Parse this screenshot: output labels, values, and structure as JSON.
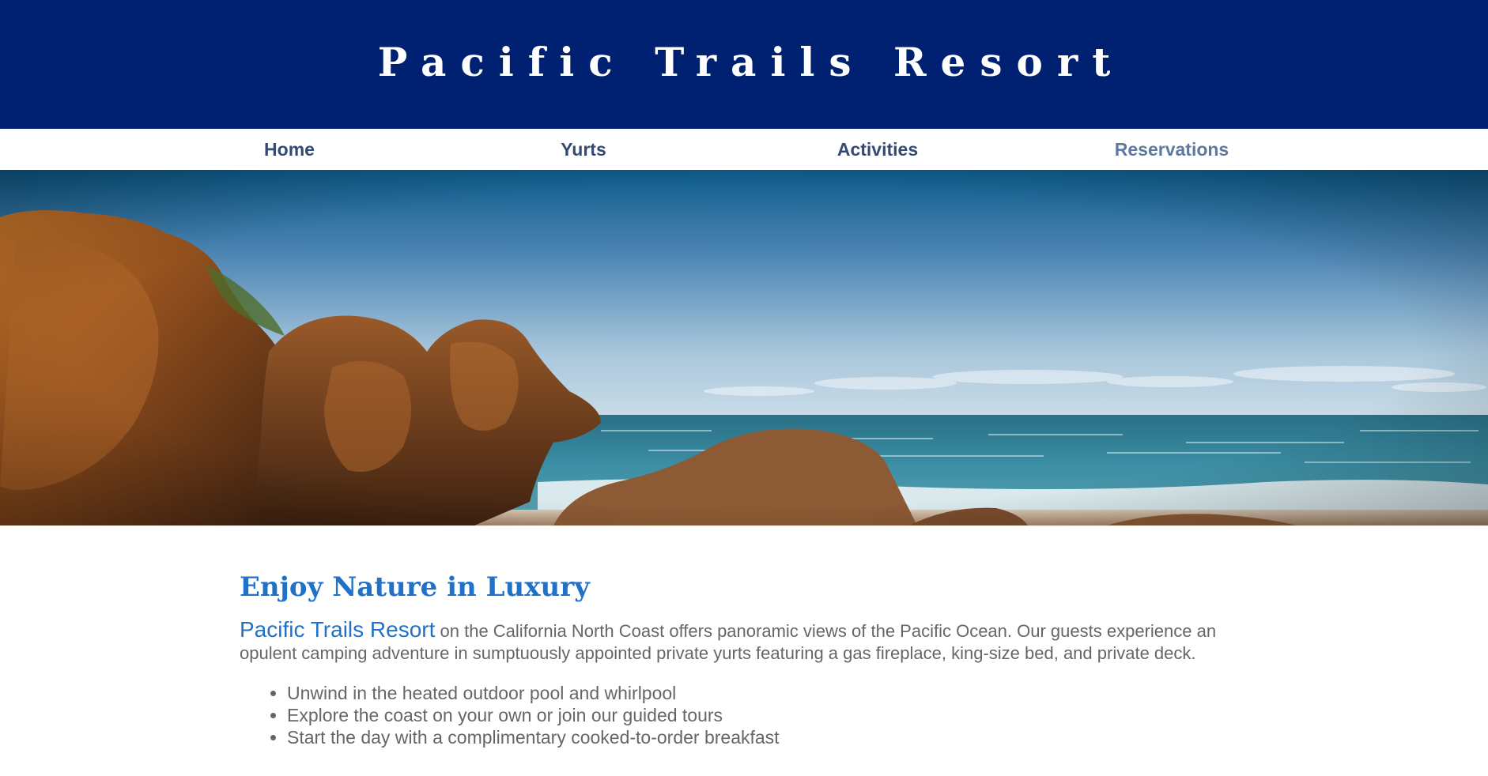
{
  "header": {
    "title": "Pacific Trails Resort"
  },
  "nav": {
    "items": [
      {
        "label": "Home"
      },
      {
        "label": "Yurts"
      },
      {
        "label": "Activities"
      },
      {
        "label": "Reservations"
      }
    ]
  },
  "hero": {
    "image_icon": "coastline-photo"
  },
  "main": {
    "heading": "Enjoy Nature in Luxury",
    "intro_brand": "Pacific Trails Resort",
    "intro_text": " on the California North Coast offers panoramic views of the Pacific Ocean. Our guests experience an opulent camping adventure in sumptuously appointed private yurts featuring a gas fireplace, king-size bed, and private deck.",
    "features": [
      "Unwind in the heated outdoor pool and whirlpool",
      "Explore the coast on your own or join our guided tours",
      "Start the day with a complimentary cooked-to-order breakfast"
    ]
  },
  "colors": {
    "header_bg": "#002171",
    "accent": "#1f72c8",
    "nav_text": "#344a72",
    "body_text": "#666666"
  }
}
